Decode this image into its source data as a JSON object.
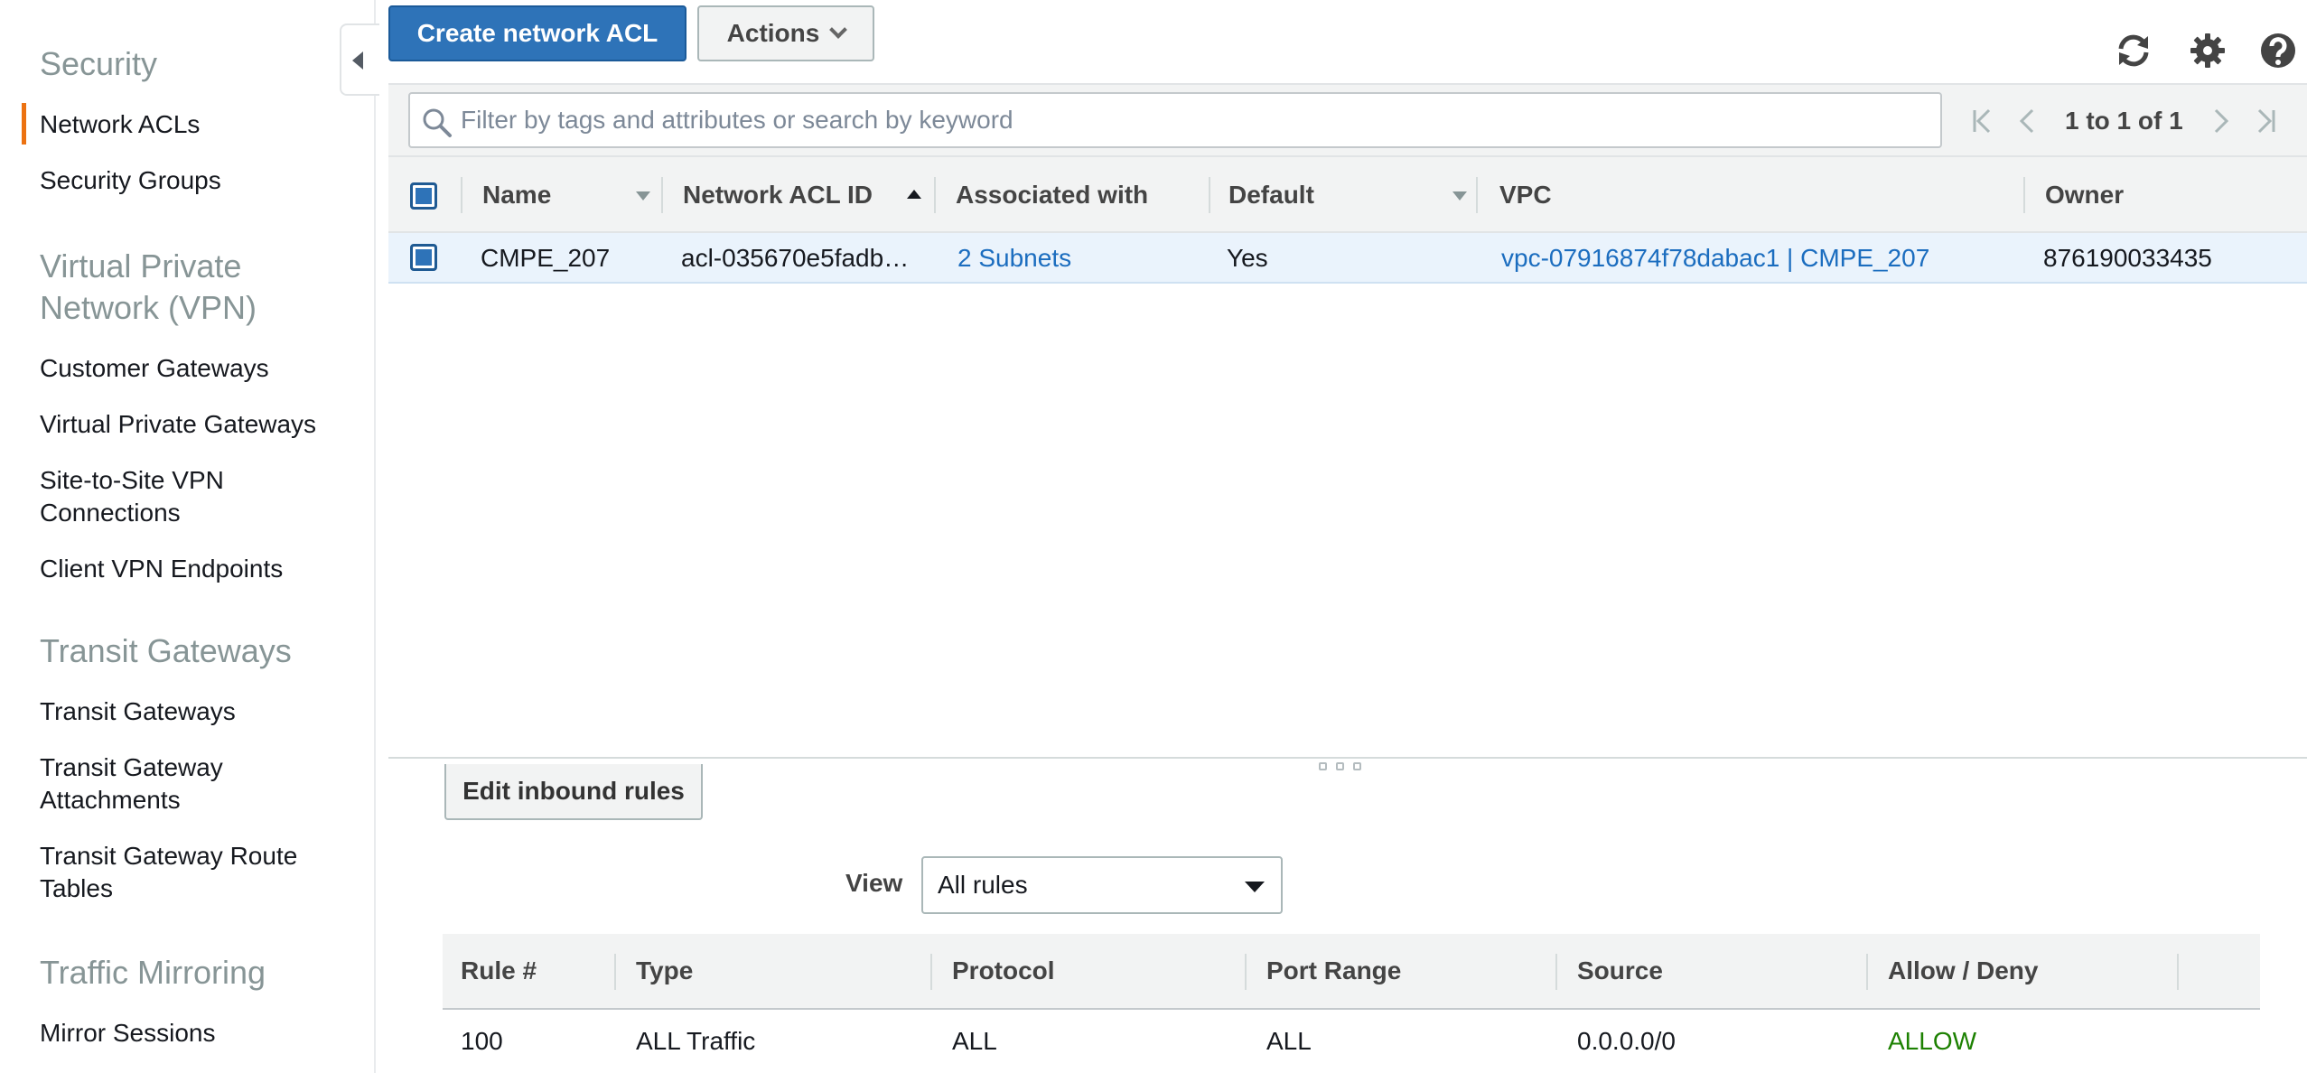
{
  "sidebar": {
    "sections": [
      {
        "title": "Security",
        "items": [
          "Network ACLs",
          "Security Groups"
        ]
      },
      {
        "title_line1": "Virtual Private",
        "title_line2": "Network (VPN)",
        "items": [
          "Customer Gateways",
          "Virtual Private Gateways",
          "Site-to-Site VPN",
          "Connections",
          "Client VPN Endpoints"
        ]
      },
      {
        "title": "Transit Gateways",
        "items": [
          "Transit Gateways",
          "Transit Gateway",
          "Attachments",
          "Transit Gateway Route",
          "Tables"
        ]
      },
      {
        "title": "Traffic Mirroring",
        "items": [
          "Mirror Sessions"
        ]
      }
    ],
    "active_item": "Network ACLs"
  },
  "toolbar": {
    "create_label": "Create network ACL",
    "actions_label": "Actions",
    "icons": [
      "refresh-icon",
      "gear-icon",
      "help-icon"
    ]
  },
  "filter": {
    "placeholder": "Filter by tags and attributes or search by keyword",
    "pager_text": "1 to 1 of 1"
  },
  "grid": {
    "columns": [
      "Name",
      "Network ACL ID",
      "Associated with",
      "Default",
      "VPC",
      "Owner"
    ],
    "rows": [
      {
        "name": "CMPE_207",
        "acl_id": "acl-035670e5fadb…",
        "associated": "2 Subnets",
        "default": "Yes",
        "vpc": "vpc-07916874f78dabac1 | CMPE_207",
        "owner": "876190033435"
      }
    ]
  },
  "details": {
    "edit_label": "Edit inbound rules",
    "view_label": "View",
    "view_value": "All rules",
    "rule_columns": [
      "Rule #",
      "Type",
      "Protocol",
      "Port Range",
      "Source",
      "Allow / Deny"
    ],
    "rules": [
      {
        "rule": "100",
        "type": "ALL Traffic",
        "protocol": "ALL",
        "port_range": "ALL",
        "source": "0.0.0.0/0",
        "action": "ALLOW"
      }
    ]
  },
  "colors": {
    "primary": "#2e73b8",
    "accent": "#ec7211",
    "link": "#1b6dbf",
    "allow": "#1d8102"
  }
}
